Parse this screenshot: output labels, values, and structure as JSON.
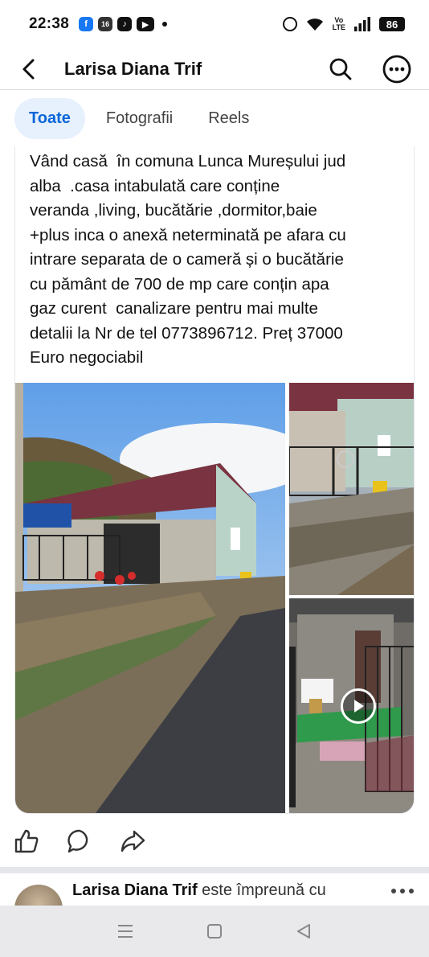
{
  "status_bar": {
    "time": "22:38",
    "apps": [
      "facebook-icon",
      "notification-badge-icon",
      "tiktok-icon",
      "youtube-icon"
    ],
    "app_badge_number": "16",
    "volte_line1": "Vo",
    "volte_line2": "LTE",
    "battery": "86"
  },
  "header": {
    "title": "Larisa Diana Trif",
    "back_icon": "back-arrow-icon",
    "search_icon": "search-icon",
    "more_icon": "more-options-icon"
  },
  "tabs": [
    {
      "label": "Toate",
      "active": true
    },
    {
      "label": "Fotografii",
      "active": false
    },
    {
      "label": "Reels",
      "active": false
    }
  ],
  "post": {
    "text": "Vând casă  în comuna Lunca Mureșului jud\nalba  .casa intabulată care conține\nveranda ,living, bucătărie ,dormitor,baie\n+plus inca o anexă neterminată pe afara cu\nintrare separata de o cameră și o bucătărie\ncu pământ de 700 de mp care conțin apa\ngaz curent  canalizare pentru mai multe\ndetalii la Nr de tel 0773896712. Preț 37000\nEuro negociabil",
    "photos": [
      "house-street-photo",
      "house-gate-photo",
      "house-veranda-video"
    ]
  },
  "reactions": [
    "like-icon",
    "comment-icon",
    "share-icon"
  ],
  "next_post": {
    "author": "Larisa Diana Trif",
    "suffix": " este împreună cu"
  },
  "colors": {
    "accent": "#0a66d8",
    "active_tab_bg": "#e7f0fd",
    "text": "#111111",
    "nav_bar": "#e9e9ec"
  }
}
